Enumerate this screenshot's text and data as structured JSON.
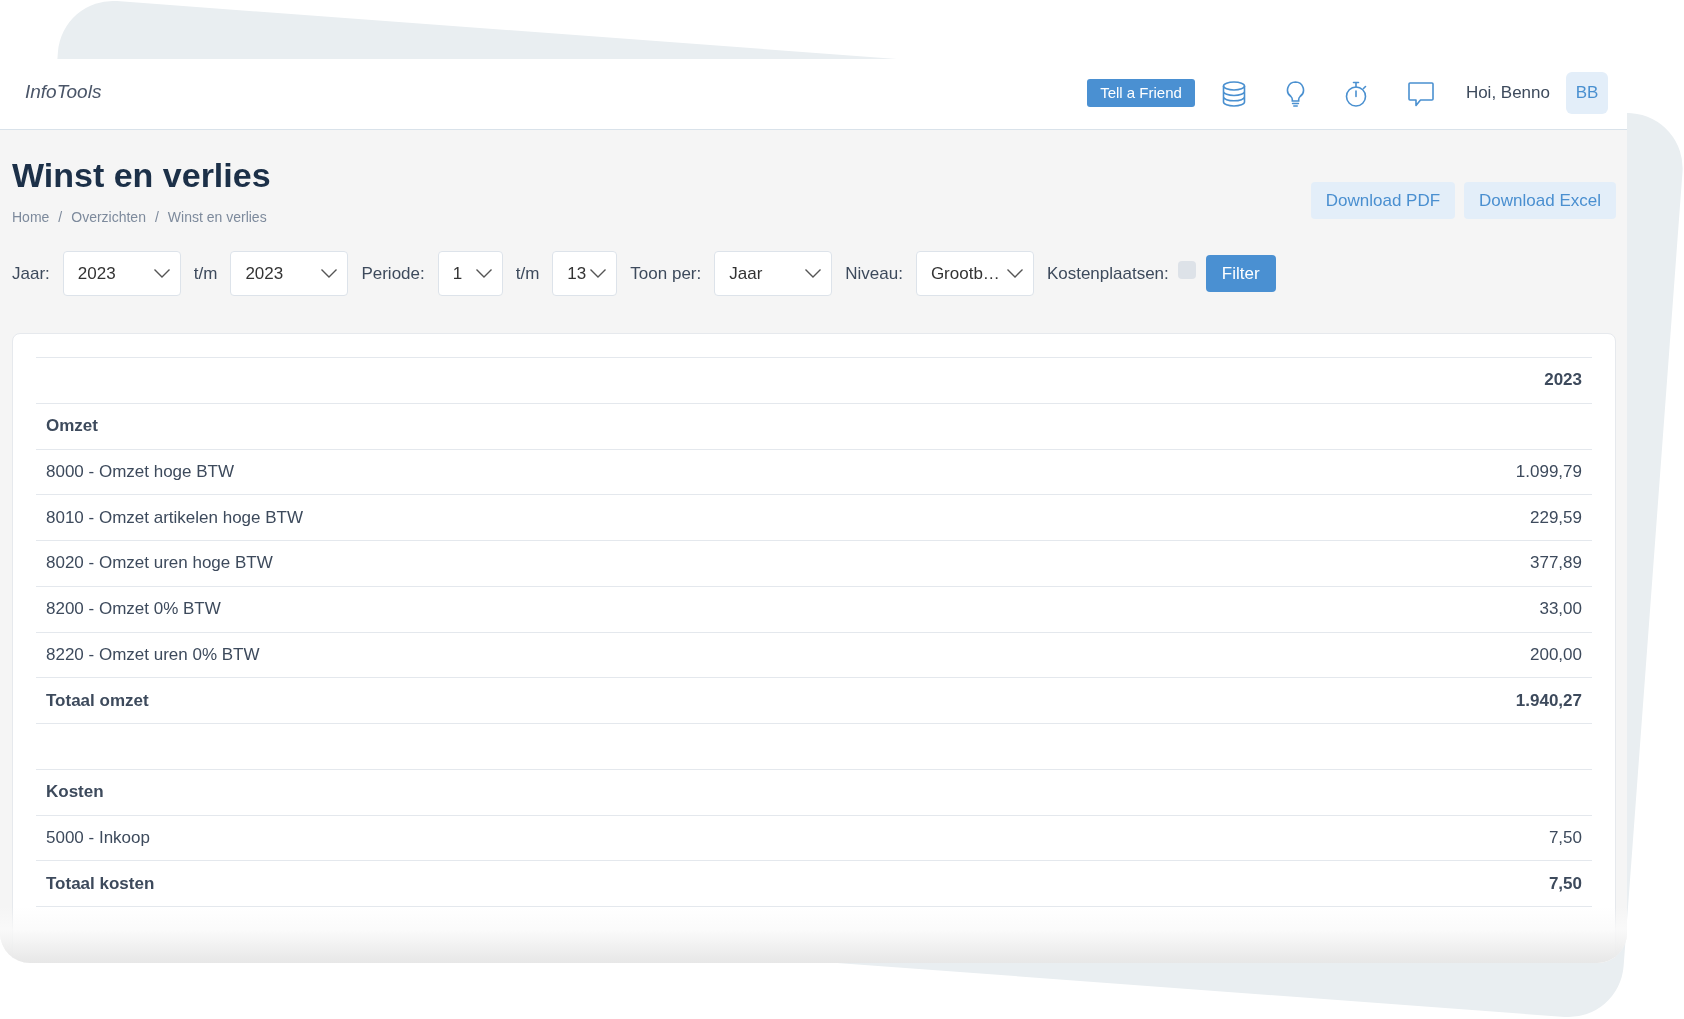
{
  "header": {
    "logo": "InfoTools",
    "tell_a_friend": "Tell a Friend",
    "greeting": "Hoi, Benno",
    "avatar_initials": "BB"
  },
  "page": {
    "title": "Winst en verlies",
    "breadcrumb": [
      {
        "text": "Home",
        "separator": "/"
      },
      {
        "text": "Overzichten",
        "separator": "/"
      },
      {
        "text": "Winst en verlies"
      }
    ],
    "downloads": [
      "Download PDF",
      "Download Excel"
    ]
  },
  "filters": [
    {
      "kind": "label",
      "text": "Jaar:"
    },
    {
      "kind": "select",
      "value": "2023"
    },
    {
      "kind": "label",
      "text": "t/m"
    },
    {
      "kind": "select",
      "value": "2023"
    },
    {
      "kind": "label",
      "text": "Periode:"
    },
    {
      "kind": "select",
      "value": "1"
    },
    {
      "kind": "label",
      "text": "t/m"
    },
    {
      "kind": "select",
      "value": "13"
    },
    {
      "kind": "label",
      "text": "Toon per:"
    },
    {
      "kind": "select",
      "value": "Jaar"
    },
    {
      "kind": "label",
      "text": "Niveau:"
    },
    {
      "kind": "select",
      "value": "Grootb…"
    },
    {
      "kind": "label",
      "text": "Kostenplaatsen:"
    },
    {
      "kind": "checkbox",
      "checked": false
    },
    {
      "kind": "button",
      "label": "Filter"
    }
  ],
  "table": {
    "value_column_heading": "2023",
    "rows": [
      {
        "kind": "section",
        "label": "Omzet"
      },
      {
        "kind": "account",
        "label": "8000 - Omzet hoge BTW",
        "value": "1.099,79"
      },
      {
        "kind": "account",
        "label": "8010 - Omzet artikelen hoge BTW",
        "value": "229,59"
      },
      {
        "kind": "account",
        "label": "8020 - Omzet uren hoge BTW",
        "value": "377,89"
      },
      {
        "kind": "account",
        "label": "8200 - Omzet 0% BTW",
        "value": "33,00"
      },
      {
        "kind": "account",
        "label": "8220 - Omzet uren 0% BTW",
        "value": "200,00"
      },
      {
        "kind": "total",
        "label": "Totaal omzet",
        "value": "1.940,27"
      },
      {
        "kind": "spacer"
      },
      {
        "kind": "section",
        "label": "Kosten"
      },
      {
        "kind": "account",
        "label": "5000 - Inkoop",
        "value": "7,50"
      },
      {
        "kind": "total",
        "label": "Totaal kosten",
        "value": "7,50"
      }
    ]
  }
}
